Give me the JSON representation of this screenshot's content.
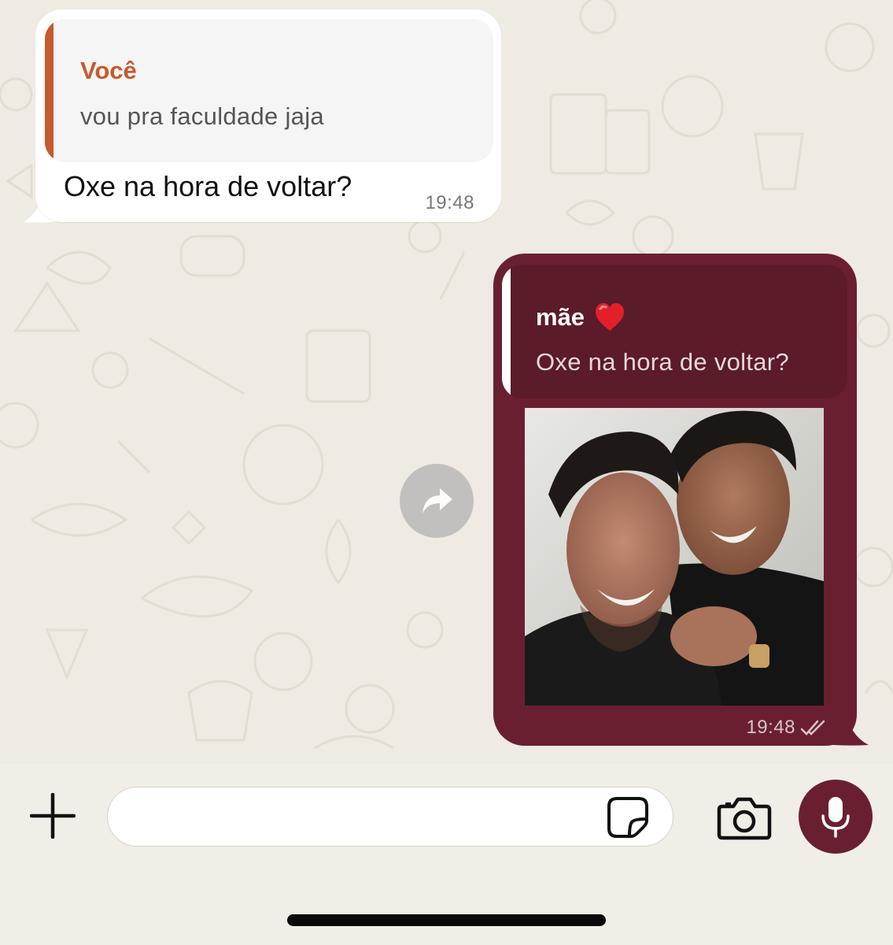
{
  "chat": {
    "incoming": {
      "quote_author": "Você",
      "quote_text": "vou pra faculdade jaja",
      "text": "Oxe na hora de voltar?",
      "time": "19:48"
    },
    "outgoing": {
      "quote_author": "mãe",
      "quote_emoji": "heart-emoji",
      "quote_text": "Oxe na hora de voltar?",
      "media": "photo-two-men-laughing",
      "time": "19:48",
      "status": "delivered-double-check"
    }
  },
  "composer": {
    "placeholder": "",
    "icons": [
      "plus-icon",
      "sticker-icon",
      "camera-icon",
      "microphone-icon"
    ]
  },
  "colors": {
    "accent": "#6a1f31",
    "quote_you": "#c55a2e",
    "background": "#efeae2"
  }
}
